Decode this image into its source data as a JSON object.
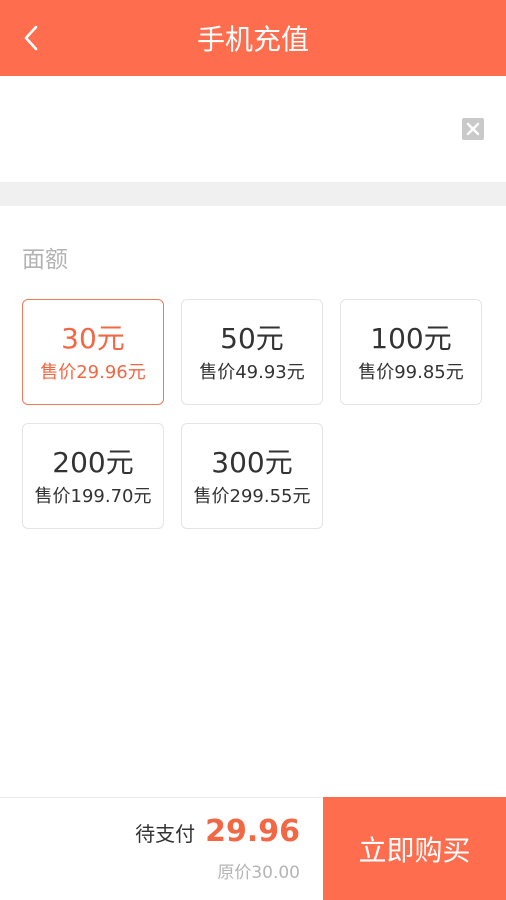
{
  "header": {
    "title": "手机充值",
    "back_icon": "chevron-left-icon",
    "color": "#fe6d4e"
  },
  "phone": {
    "value": "",
    "clear_icon": "close-icon"
  },
  "amounts": {
    "label": "面额",
    "items": [
      {
        "face": "30元",
        "price": "售价29.96元",
        "selected": true
      },
      {
        "face": "50元",
        "price": "售价49.93元",
        "selected": false
      },
      {
        "face": "100元",
        "price": "售价99.85元",
        "selected": false
      },
      {
        "face": "200元",
        "price": "售价199.70元",
        "selected": false
      },
      {
        "face": "300元",
        "price": "售价299.55元",
        "selected": false
      }
    ]
  },
  "footer": {
    "pay_label": "待支付",
    "pay_amount": "29.96",
    "original_price": "原价30.00",
    "buy_label": "立即购买"
  },
  "colors": {
    "accent": "#fe6d4e",
    "selected_text": "#f26744"
  }
}
